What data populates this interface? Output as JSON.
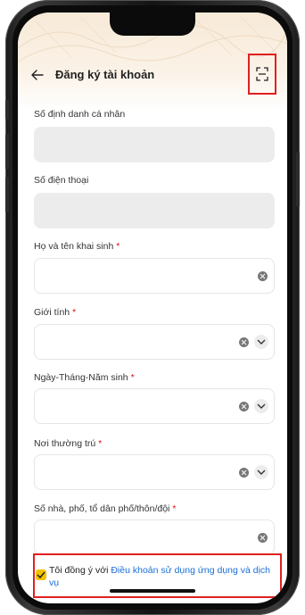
{
  "header": {
    "title": "Đăng ký tài khoản",
    "back_icon": "arrow-left-icon",
    "scan_icon": "scan-qr-icon"
  },
  "form": {
    "fields": [
      {
        "label": "Số định danh cá nhân",
        "required": false,
        "value": "",
        "state": "disabled"
      },
      {
        "label": "Số điện thoại",
        "required": false,
        "value": "",
        "state": "disabled"
      },
      {
        "label": "Họ và tên khai sinh",
        "required": true,
        "value": "",
        "state": "text"
      },
      {
        "label": "Giới tính",
        "required": true,
        "value": "",
        "state": "select"
      },
      {
        "label": "Ngày-Tháng-Năm sinh",
        "required": true,
        "value": "",
        "state": "select"
      },
      {
        "label": "Nơi thường trú",
        "required": true,
        "value": "",
        "state": "select"
      },
      {
        "label": "Số nhà, phố, tổ dân phố/thôn/đội",
        "required": true,
        "value": "",
        "state": "text"
      }
    ],
    "required_mark": "*"
  },
  "agreement": {
    "prefix": "Tôi đồng ý với ",
    "link": "Điều khoản sử dụng ứng dụng và dịch vụ",
    "checked": true
  },
  "colors": {
    "accent_highlight": "#e02020",
    "checkbox": "#f2c200",
    "link": "#1a6fd6",
    "required": "#dd1111"
  }
}
